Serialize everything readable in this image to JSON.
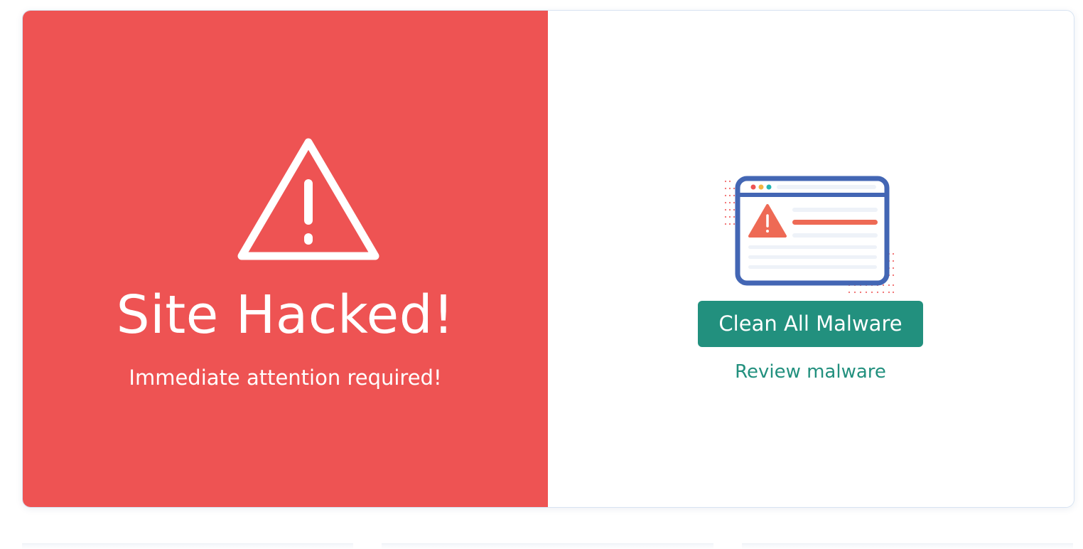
{
  "status_panel": {
    "title": "Site Hacked!",
    "subtitle": "Immediate attention required!",
    "icon": "warning-triangle-icon",
    "background_color": "#ee5353"
  },
  "action_panel": {
    "illustration": "browser-warning-illustration",
    "primary_button_label": "Clean All Malware",
    "secondary_link_label": "Review malware",
    "accent_color": "#22907e"
  }
}
